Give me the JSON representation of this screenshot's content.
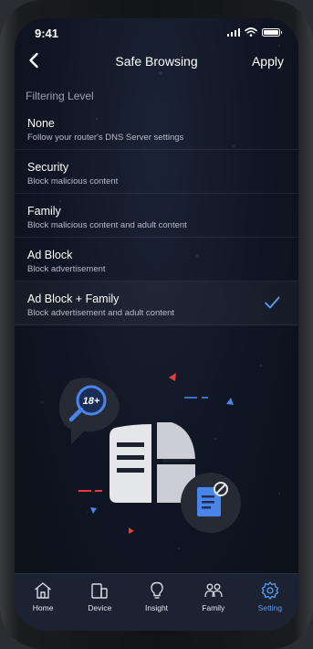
{
  "status_bar": {
    "time": "9:41"
  },
  "header": {
    "title": "Safe Browsing",
    "apply_label": "Apply"
  },
  "section_title": "Filtering Level",
  "options": [
    {
      "title": "None",
      "subtitle": "Follow your router's DNS  Server settings",
      "selected": false
    },
    {
      "title": "Security",
      "subtitle": "Block malicious content",
      "selected": false
    },
    {
      "title": "Family",
      "subtitle": "Block malicious content and adult content",
      "selected": false
    },
    {
      "title": "Ad Block",
      "subtitle": "Block advertisement",
      "selected": false
    },
    {
      "title": "Ad Block + Family",
      "subtitle": "Block advertisement and adult content",
      "selected": true
    }
  ],
  "illustration": {
    "badge_text": "18+"
  },
  "tabs": [
    {
      "label": "Home",
      "icon": "home-icon",
      "active": false
    },
    {
      "label": "Device",
      "icon": "device-icon",
      "active": false
    },
    {
      "label": "Insight",
      "icon": "lightbulb-icon",
      "active": false
    },
    {
      "label": "Family",
      "icon": "family-icon",
      "active": false
    },
    {
      "label": "Setting",
      "icon": "gear-icon",
      "active": true
    }
  ],
  "colors": {
    "accent": "#5b9cf6",
    "background": "#0f1522",
    "tab_bar": "#1b2231"
  }
}
